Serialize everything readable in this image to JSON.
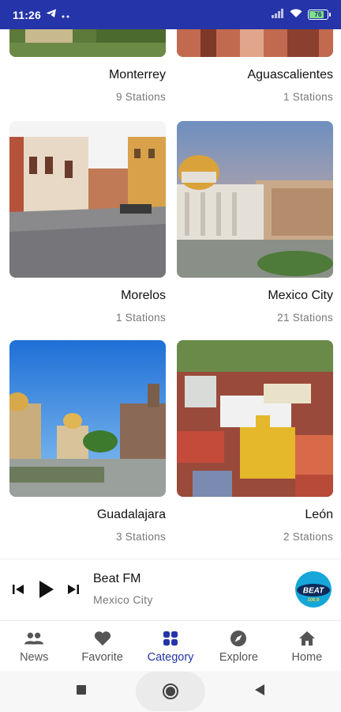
{
  "status_bar": {
    "time": "11:26",
    "battery": "76"
  },
  "cities": [
    {
      "name": "Monterrey",
      "stations": "9 Stations"
    },
    {
      "name": "Aguascalientes",
      "stations": "1 Stations"
    },
    {
      "name": "Morelos",
      "stations": "1 Stations"
    },
    {
      "name": "Mexico City",
      "stations": "21 Stations"
    },
    {
      "name": "Guadalajara",
      "stations": "3 Stations"
    },
    {
      "name": "León",
      "stations": "2 Stations"
    }
  ],
  "player": {
    "title": "Beat FM",
    "subtitle": "Mexico City",
    "logo_text": "BEAT",
    "logo_sub": "100.9"
  },
  "bottom_nav": [
    {
      "label": "News",
      "icon": "people-icon"
    },
    {
      "label": "Favorite",
      "icon": "heart-icon"
    },
    {
      "label": "Category",
      "icon": "grid-icon",
      "active": true
    },
    {
      "label": "Explore",
      "icon": "compass-icon"
    },
    {
      "label": "Home",
      "icon": "home-icon"
    }
  ],
  "colors": {
    "accent": "#2534a8",
    "status_bar": "#2534a8",
    "muted": "#777777"
  }
}
